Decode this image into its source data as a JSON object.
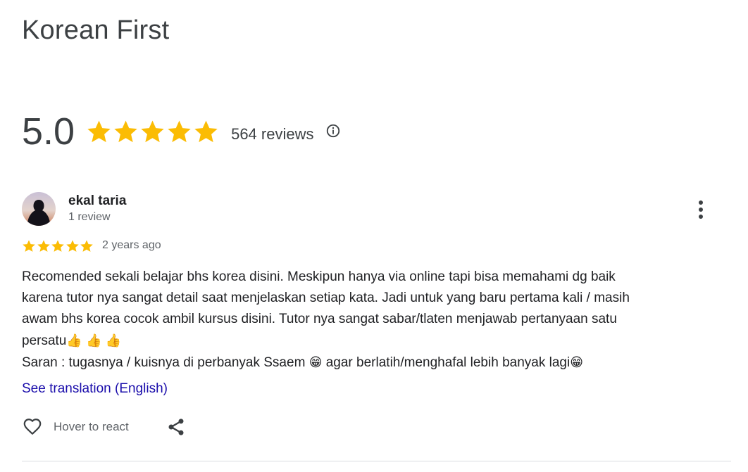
{
  "place": {
    "title": "Korean First"
  },
  "rating": {
    "score": "5.0",
    "stars": 5,
    "reviews_label": "564 reviews"
  },
  "review": {
    "author": "ekal taria",
    "author_meta": "1 review",
    "stars": 5,
    "date": "2 years ago",
    "text_lines": [
      "Recomended sekali belajar bhs korea disini. Meskipun hanya via online tapi bisa memahami dg baik",
      "karena tutor nya sangat detail saat menjelaskan setiap kata. Jadi untuk yang baru pertama kali / masih",
      "awam bhs korea cocok ambil kursus disini. Tutor nya sangat sabar/tlaten menjawab pertanyaan satu",
      "persatu",
      "Saran : tugasnya / kuisnya di perbanyak Ssaem",
      "agar berlatih/menghafal lebih banyak lagi"
    ],
    "emojis": {
      "thumbs": "👍",
      "grin": "😁"
    },
    "translate_label": "See translation (English)",
    "react_label": "Hover to react"
  },
  "icons": [
    "star-icon",
    "info-icon",
    "more-options-icon",
    "heart-icon",
    "share-icon"
  ],
  "colors": {
    "star": "#fbbc04",
    "link": "#1a0dab",
    "muted": "#5f6368",
    "text": "#202124"
  }
}
